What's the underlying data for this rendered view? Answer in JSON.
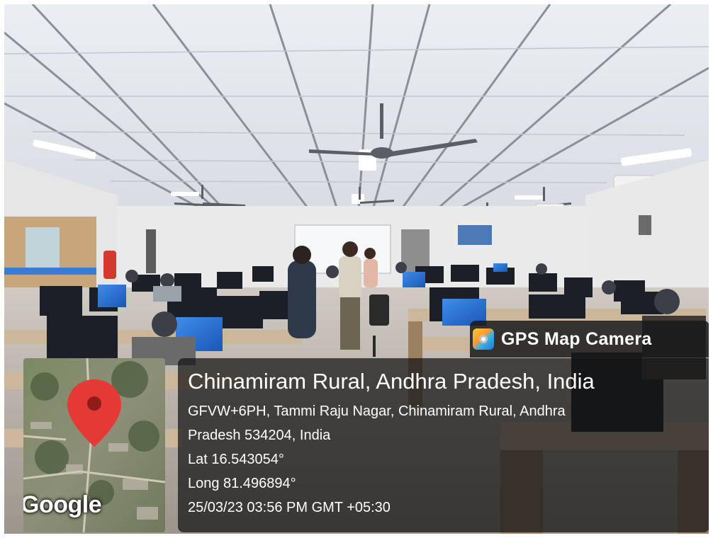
{
  "stamp": {
    "app_name": "GPS Map Camera",
    "place_title": "Chinamiram Rural, Andhra Pradesh, India",
    "address_line1": "GFVW+6PH, Tammi Raju Nagar, Chinamiram Rural, Andhra",
    "address_line2": "Pradesh 534204, India",
    "lat": "Lat 16.543054°",
    "long": "Long 81.496894°",
    "datetime": "25/03/23 03:56 PM GMT +05:30",
    "map_brand": "Google"
  },
  "colors": {
    "map_pin": "#e53935",
    "stamp_background": "#141414"
  },
  "icons": {
    "app_icon": "gps-map-camera-icon",
    "pin": "map-pin-icon"
  }
}
